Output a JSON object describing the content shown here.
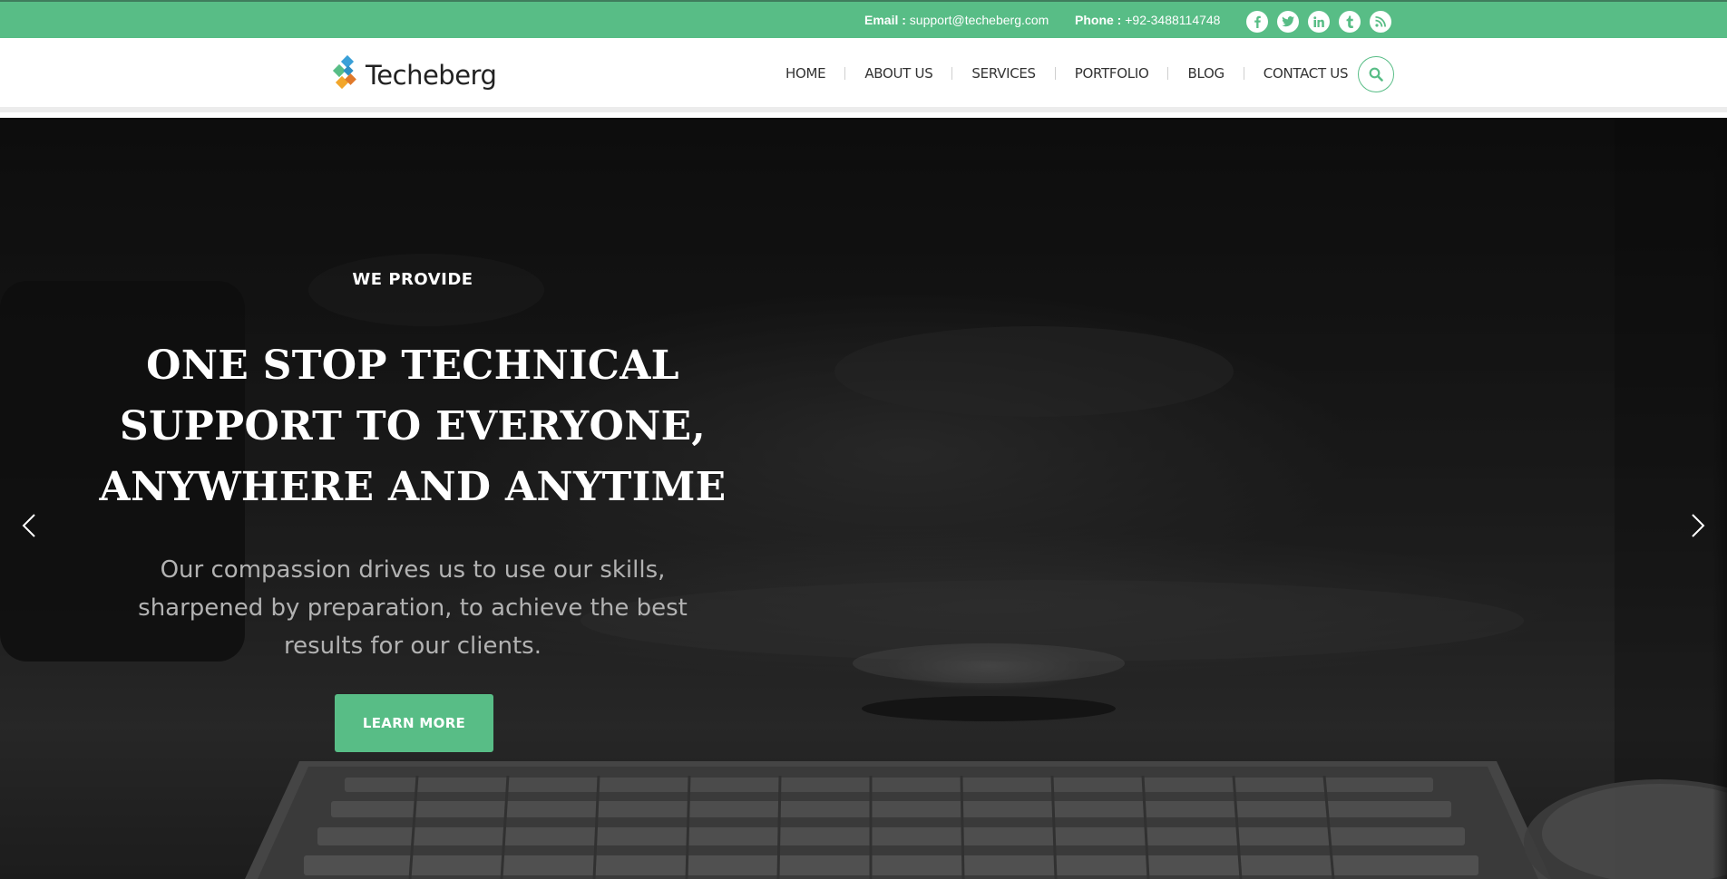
{
  "topbar": {
    "email_label": "Email :",
    "email_value": "support@techeberg.com",
    "phone_label": "Phone :",
    "phone_value": "+92-3488114748",
    "social": [
      {
        "icon": "facebook-icon",
        "glyph": "f"
      },
      {
        "icon": "twitter-icon",
        "glyph": "t"
      },
      {
        "icon": "linkedin-icon",
        "glyph": "in"
      },
      {
        "icon": "tumblr-icon",
        "glyph": "t"
      },
      {
        "icon": "rss-icon",
        "glyph": "rss"
      }
    ]
  },
  "header": {
    "logo_text": "Techeberg",
    "nav": [
      "HOME",
      "ABOUT US",
      "SERVICES",
      "PORTFOLIO",
      "BLOG",
      "CONTACT US"
    ],
    "search_icon": "search-icon"
  },
  "hero": {
    "eyebrow": "WE PROVIDE",
    "title_lines": [
      "ONE STOP TECHNICAL",
      "SUPPORT TO EVERYONE,",
      "ANYWHERE AND ANYTIME"
    ],
    "desc_lines": [
      "Our compassion drives us to use our skills,",
      "sharpened by preparation, to achieve the best",
      "results for our clients."
    ],
    "cta_label": "LEARN MORE",
    "prev_icon": "chevron-left-icon",
    "next_icon": "chevron-right-icon"
  },
  "colors": {
    "accent": "#58bd86",
    "hero_bg": "#1f1f1f"
  }
}
